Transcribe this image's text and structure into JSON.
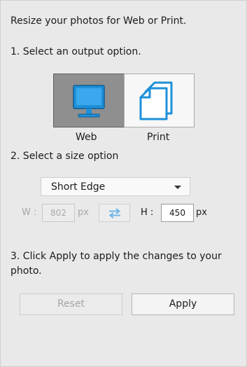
{
  "intro": "Resize your photos for Web or Print.",
  "steps": {
    "output": "1. Select an output option.",
    "size": "2. Select a size option",
    "apply": "3. Click Apply to apply the changes to your photo."
  },
  "output_options": {
    "web": {
      "label": "Web",
      "selected": true,
      "icon": "monitor-icon"
    },
    "print": {
      "label": "Print",
      "selected": false,
      "icon": "pages-icon"
    }
  },
  "size_option": {
    "selected": "Short Edge"
  },
  "dimensions": {
    "width_label": "W :",
    "width_value": "802",
    "width_unit": "px",
    "width_enabled": false,
    "height_label": "H :",
    "height_value": "450",
    "height_unit": "px",
    "height_enabled": true,
    "swap_icon": "swap-arrows-icon"
  },
  "buttons": {
    "reset": {
      "label": "Reset",
      "enabled": false
    },
    "apply": {
      "label": "Apply",
      "enabled": true
    }
  },
  "colors": {
    "icon_blue": "#1e90d8",
    "panel_bg": "#e9e9e9",
    "selected_option_bg": "#8f8f8f"
  }
}
